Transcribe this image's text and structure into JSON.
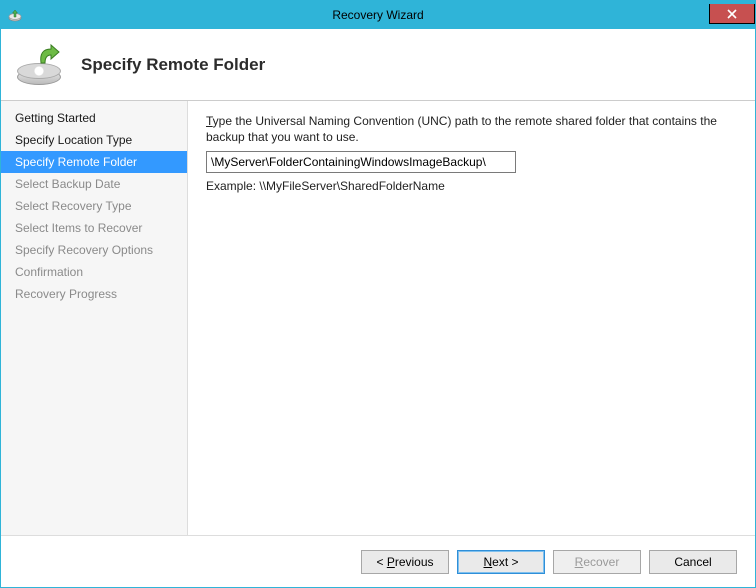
{
  "window": {
    "title": "Recovery Wizard"
  },
  "header": {
    "page_title": "Specify Remote Folder"
  },
  "sidebar": {
    "items": [
      {
        "label": "Getting Started",
        "state": "enabled"
      },
      {
        "label": "Specify Location Type",
        "state": "enabled"
      },
      {
        "label": "Specify Remote Folder",
        "state": "current"
      },
      {
        "label": "Select Backup Date",
        "state": "disabled"
      },
      {
        "label": "Select Recovery Type",
        "state": "disabled"
      },
      {
        "label": "Select Items to Recover",
        "state": "disabled"
      },
      {
        "label": "Specify Recovery Options",
        "state": "disabled"
      },
      {
        "label": "Confirmation",
        "state": "disabled"
      },
      {
        "label": "Recovery Progress",
        "state": "disabled"
      }
    ]
  },
  "main": {
    "instruction_prefix_underline_char": "T",
    "instruction_rest": "ype the Universal Naming Convention (UNC) path to the remote shared folder that contains the backup that you want to use.",
    "path_value": "\\MyServer\\FolderContainingWindowsImageBackup\\",
    "example_text": "Example: \\\\MyFileServer\\SharedFolderName"
  },
  "footer": {
    "previous": {
      "pre": "< ",
      "ul": "P",
      "post": "revious"
    },
    "next": {
      "pre": "",
      "ul": "N",
      "post": "ext >"
    },
    "recover": {
      "pre": "",
      "ul": "R",
      "post": "ecover"
    },
    "cancel": "Cancel"
  }
}
